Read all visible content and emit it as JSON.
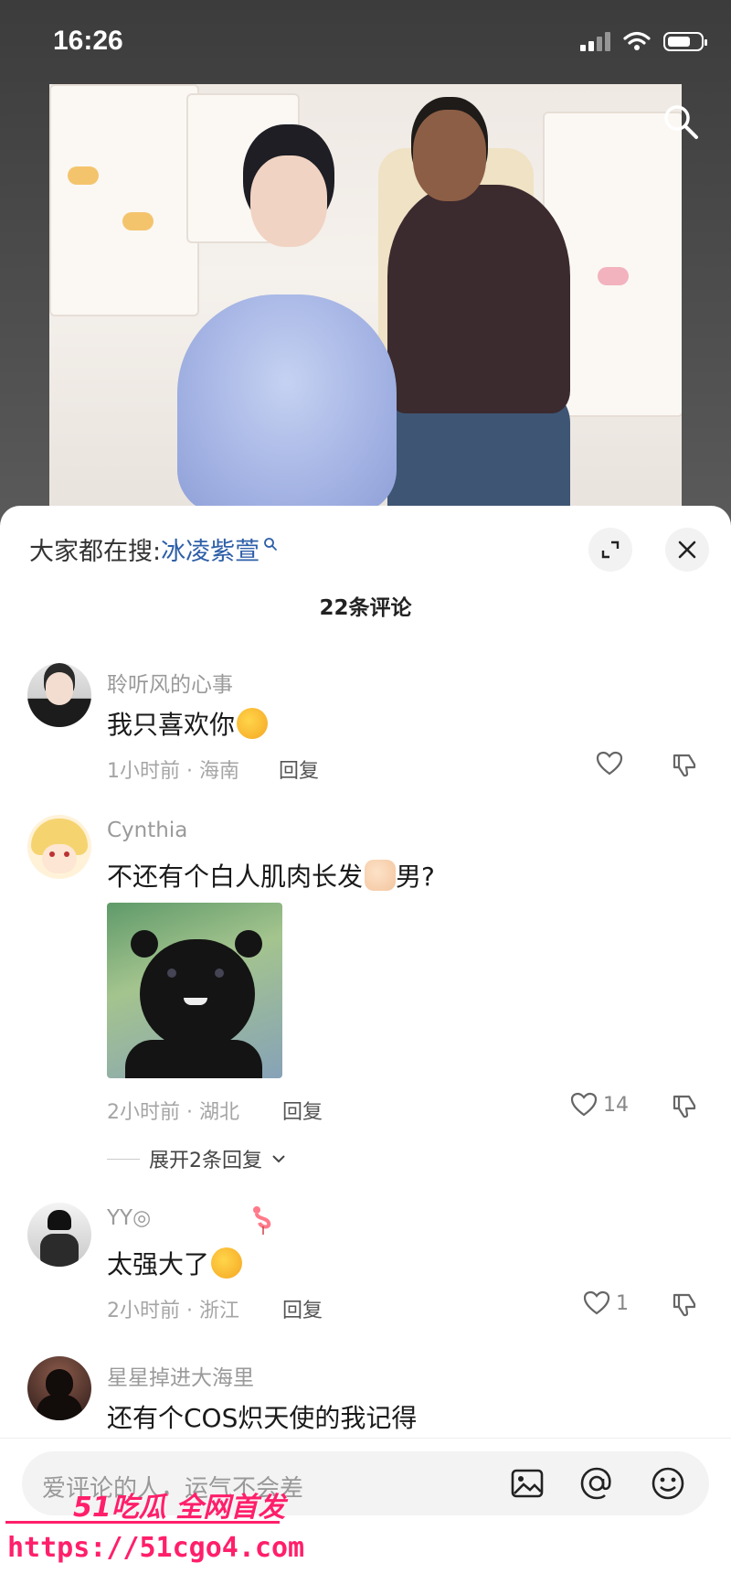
{
  "status_bar": {
    "time": "16:26"
  },
  "sheet": {
    "hot_search_prefix": "大家都在搜:",
    "hot_search_keyword": "冰凌紫萱",
    "comment_count": "22条评论"
  },
  "comments": [
    {
      "username": "聆听风的心事",
      "text": "我只喜欢你",
      "time_location": "1小时前 · 海南",
      "reply_label": "回复",
      "likes": ""
    },
    {
      "username": "Cynthia",
      "text_before": "不还有个白人肌肉长发",
      "text_after": "男?",
      "time_location": "2小时前 · 湖北",
      "reply_label": "回复",
      "likes": "14",
      "expand_label": "展开2条回复"
    },
    {
      "username": "YY◎",
      "text": "太强大了",
      "time_location": "2小时前 · 浙江",
      "reply_label": "回复",
      "likes": "1"
    },
    {
      "username": "星星掉进大海里",
      "text": "还有个COS炽天使的我记得"
    }
  ],
  "input_bar": {
    "placeholder": "爱评论的人，运气不会差"
  },
  "watermark": {
    "logo": "51吃瓜 全网首发",
    "url": "https://51cgo4.com"
  },
  "icons": {
    "photo_search": "search-icon",
    "expand": "expand-icon",
    "close": "close-icon",
    "like": "heart-icon",
    "dislike": "thumbs-down-icon",
    "image": "image-icon",
    "mention": "at-icon",
    "emoji": "emoji-icon"
  },
  "colors": {
    "keyword": "#2d5fa8",
    "watermark": "#ff1f6b"
  }
}
